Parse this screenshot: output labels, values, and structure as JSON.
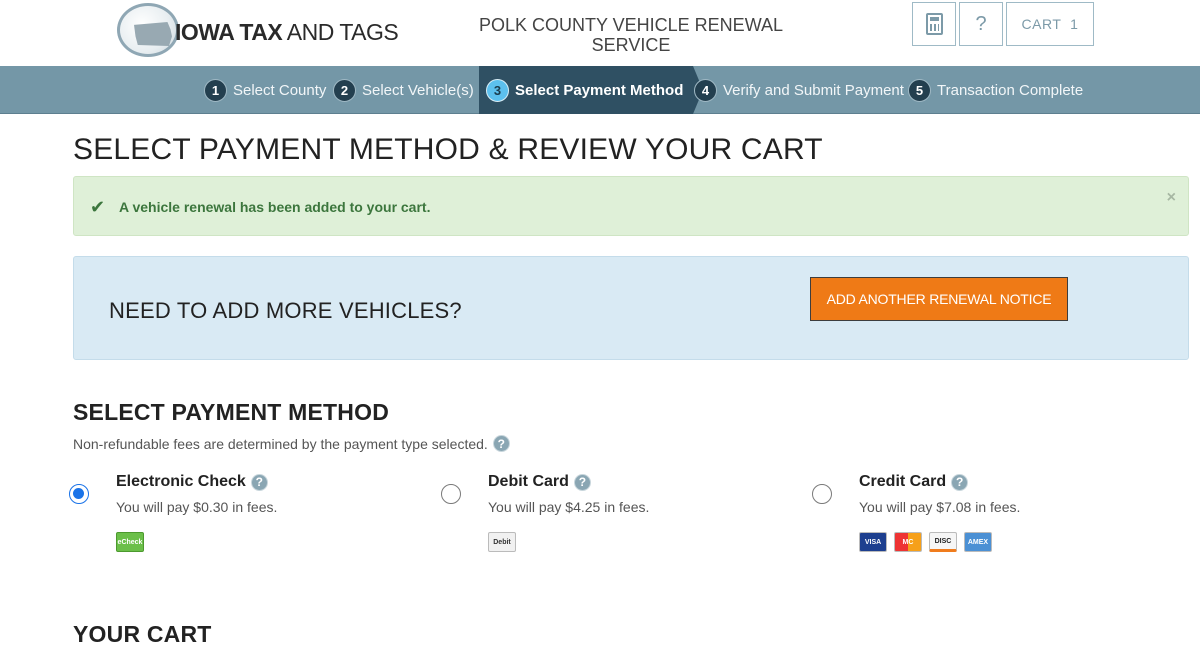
{
  "header": {
    "logo": {
      "bold": "IOWA TAX",
      "light": "AND TAGS"
    },
    "service_title": "POLK COUNTY VEHICLE RENEWAL SERVICE",
    "calc_icon": "calculator-icon",
    "help_label": "?",
    "cart_label": "CART",
    "cart_count": "1"
  },
  "steps": [
    {
      "num": "1",
      "label": "Select County"
    },
    {
      "num": "2",
      "label": "Select Vehicle(s)"
    },
    {
      "num": "3",
      "label": "Select Payment Method",
      "active": true
    },
    {
      "num": "4",
      "label": "Verify and Submit Payment"
    },
    {
      "num": "5",
      "label": "Transaction Complete"
    }
  ],
  "page_title": "SELECT PAYMENT METHOD & REVIEW YOUR CART",
  "alert": {
    "icon": "checkmark-icon",
    "text": "A vehicle renewal has been added to your cart.",
    "close": "×"
  },
  "more_vehicles": {
    "title": "NEED TO ADD MORE VEHICLES?",
    "button": "ADD ANOTHER RENEWAL NOTICE"
  },
  "payment_method": {
    "title": "SELECT PAYMENT METHOD",
    "note": "Non-refundable fees are determined by the payment type selected.",
    "help_icon": "?",
    "options": [
      {
        "name": "Electronic Check",
        "fee": "You will pay $0.30 in fees.",
        "selected": true,
        "logos": [
          "eCheck"
        ]
      },
      {
        "name": "Debit Card",
        "fee": "You will pay $4.25 in fees.",
        "selected": false,
        "logos": [
          "Debit"
        ]
      },
      {
        "name": "Credit Card",
        "fee": "You will pay $7.08 in fees.",
        "selected": false,
        "logos": [
          "VISA",
          "MC",
          "DISC",
          "AMEX"
        ]
      }
    ]
  },
  "cart_title": "YOUR CART",
  "colors": {
    "steps_bar": "#7497a7",
    "active_step": "#2f5063",
    "alert_bg": "#dff0d8",
    "info_bg": "#d9eaf4",
    "add_button": "#ef7a16",
    "radio_selected": "#1a73e8"
  }
}
